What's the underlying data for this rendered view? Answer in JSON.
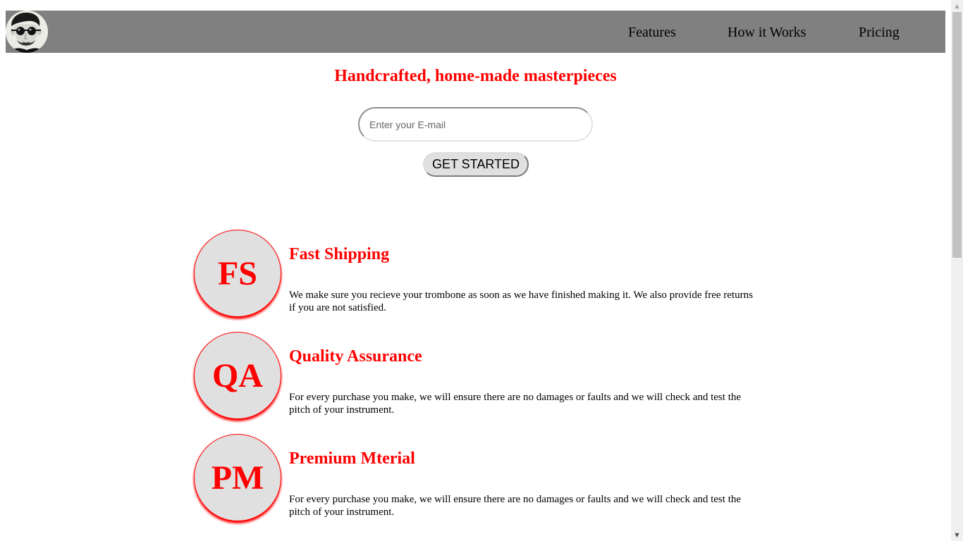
{
  "header": {
    "logo_alt": "avatar logo",
    "nav": [
      {
        "label": "Features",
        "icon": "none"
      },
      {
        "label": "How it Works"
      },
      {
        "label": "Pricing"
      }
    ]
  },
  "hero": {
    "title": "Handcrafted, home-made masterpieces",
    "email_placeholder": "Enter your E-mail",
    "email_value": "",
    "cta_label": "GET STARTED"
  },
  "features": [
    {
      "badge": "FS",
      "title": "Fast Shipping",
      "text": "We make sure you recieve your trombone as soon as we have finished making it. We also provide free returns if you are not satisfied."
    },
    {
      "badge": "QA",
      "title": "Quality Assurance",
      "text": "For every purchase you make, we will ensure there are no damages or faults and we will check and test the pitch of your instrument."
    },
    {
      "badge": "PM",
      "title": "Premium Mterial",
      "text": "For every purchase you make, we will ensure there are no damages or faults and we will check and test the pitch of your instrument."
    }
  ],
  "colors": {
    "header_bg": "#808080",
    "accent": "#ff0000",
    "badge_bg": "#e0e0e0"
  },
  "scrollbar": {
    "up_icon": "scroll-up-arrow-icon",
    "down_icon": "scroll-down-arrow-icon"
  }
}
